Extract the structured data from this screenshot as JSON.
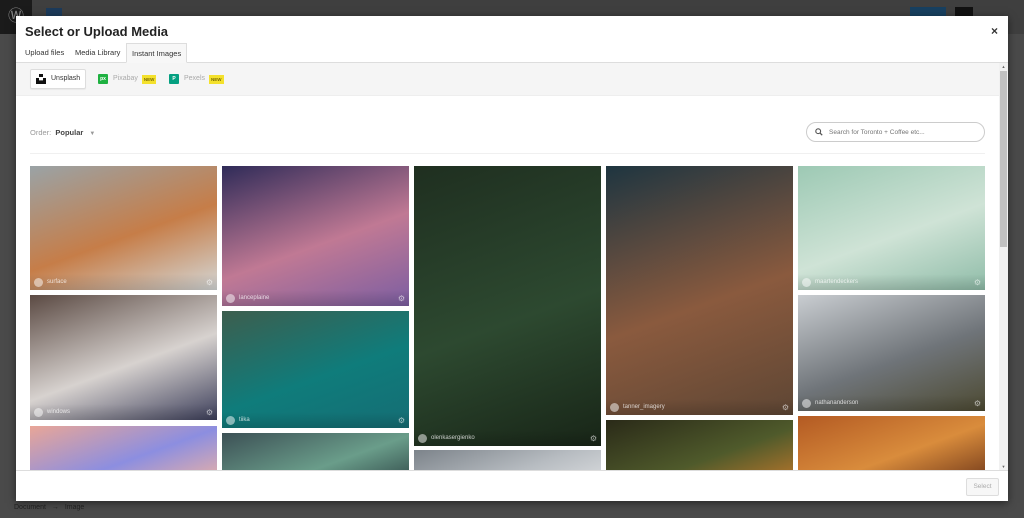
{
  "background": {
    "footer_breadcrumb": [
      "Document",
      "→",
      "Image"
    ]
  },
  "modal": {
    "title": "Select or Upload Media",
    "close_label": "×",
    "tabs": [
      {
        "label": "Upload files",
        "active": false
      },
      {
        "label": "Media Library",
        "active": false
      },
      {
        "label": "Instant Images",
        "active": true
      }
    ],
    "providers": [
      {
        "label": "Unsplash",
        "icon": "unsplash-icon",
        "active": true,
        "badge": null
      },
      {
        "label": "Pixabay",
        "icon": "pixabay-icon",
        "active": false,
        "badge": "NEW"
      },
      {
        "label": "Pexels",
        "icon": "pexels-icon",
        "active": false,
        "badge": "NEW"
      }
    ],
    "order": {
      "label": "Order:",
      "value": "Popular"
    },
    "search": {
      "placeholder": "Search for Toronto + Coffee etc...",
      "value": ""
    },
    "photos": [
      {
        "user": "surface",
        "colors": [
          "#9aa3a6",
          "#c67d48",
          "#d4d7d6"
        ]
      },
      {
        "user": "windows",
        "colors": [
          "#5b4a43",
          "#d7d2cf",
          "#3d3f5b"
        ]
      },
      {
        "user": "",
        "colors": [
          "#e9a697",
          "#8c8ee0",
          "#f0b3a2"
        ]
      },
      {
        "user": "lanceplaine",
        "colors": [
          "#2f2b58",
          "#c07994",
          "#7c5ea2"
        ]
      },
      {
        "user": "tiika",
        "colors": [
          "#3d5e4e",
          "#0f7c7b",
          "#156d74"
        ]
      },
      {
        "user": "",
        "colors": [
          "#3c5055",
          "#6a9d8a",
          "#263a3d"
        ]
      },
      {
        "user": "olenkasergienko",
        "colors": [
          "#1f2f20",
          "#2d4930",
          "#182517"
        ]
      },
      {
        "user": "",
        "colors": [
          "#7c838a",
          "#b7bcc1",
          "#dfe1e3"
        ]
      },
      {
        "user": "tanner_imagery",
        "colors": [
          "#1e3540",
          "#8a5a3e",
          "#5e4634"
        ]
      },
      {
        "user": "",
        "colors": [
          "#2a2a18",
          "#4f5a2b",
          "#c77a2b"
        ]
      },
      {
        "user": "maartendeckers",
        "colors": [
          "#9dc9b4",
          "#cfe3d6",
          "#8fbca8"
        ]
      },
      {
        "user": "nathananderson",
        "colors": [
          "#c9cdd1",
          "#6f7479",
          "#4d4a32"
        ]
      },
      {
        "user": "",
        "colors": [
          "#b35a23",
          "#d98c3c",
          "#6b3418"
        ]
      }
    ],
    "select_label": "Select"
  }
}
